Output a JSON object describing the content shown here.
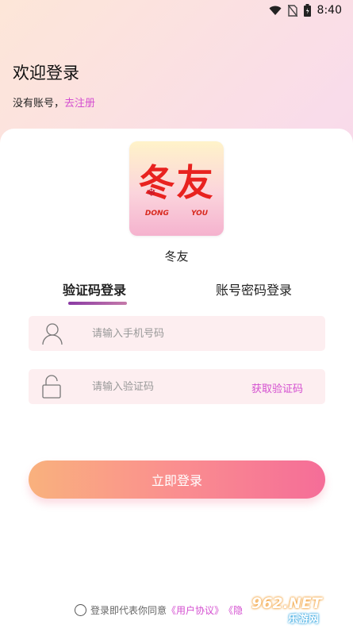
{
  "status_bar": {
    "time": "8:40"
  },
  "header": {
    "title": "欢迎登录",
    "no_account_text": "没有账号，",
    "signup_link": "去注册"
  },
  "logo": {
    "main_text": "冬友",
    "sub_left": "DONG",
    "sub_right": "YOU"
  },
  "app_name": "冬友",
  "tabs": [
    {
      "label": "验证码登录",
      "active": true
    },
    {
      "label": "账号密码登录",
      "active": false
    }
  ],
  "phone_field": {
    "placeholder": "请输入手机号码",
    "value": ""
  },
  "code_field": {
    "placeholder": "请输入验证码",
    "value": "",
    "get_code_label": "获取验证码"
  },
  "login_button": {
    "label": "立即登录"
  },
  "agreement": {
    "prefix": "登录即代表你同意",
    "user_agreement": "《用户协议》",
    "privacy_partial": "《隐"
  },
  "watermark": {
    "brand": "962.NET",
    "sub": "乐游网"
  },
  "colors": {
    "accent": "#d44fd0",
    "button_start": "#f9b17d",
    "button_end": "#f56d98",
    "field_bg": "#fdeef0"
  },
  "icons": [
    "wifi-icon",
    "no-sim-icon",
    "battery-icon",
    "user-icon",
    "lock-icon",
    "checkbox-circle-icon"
  ]
}
